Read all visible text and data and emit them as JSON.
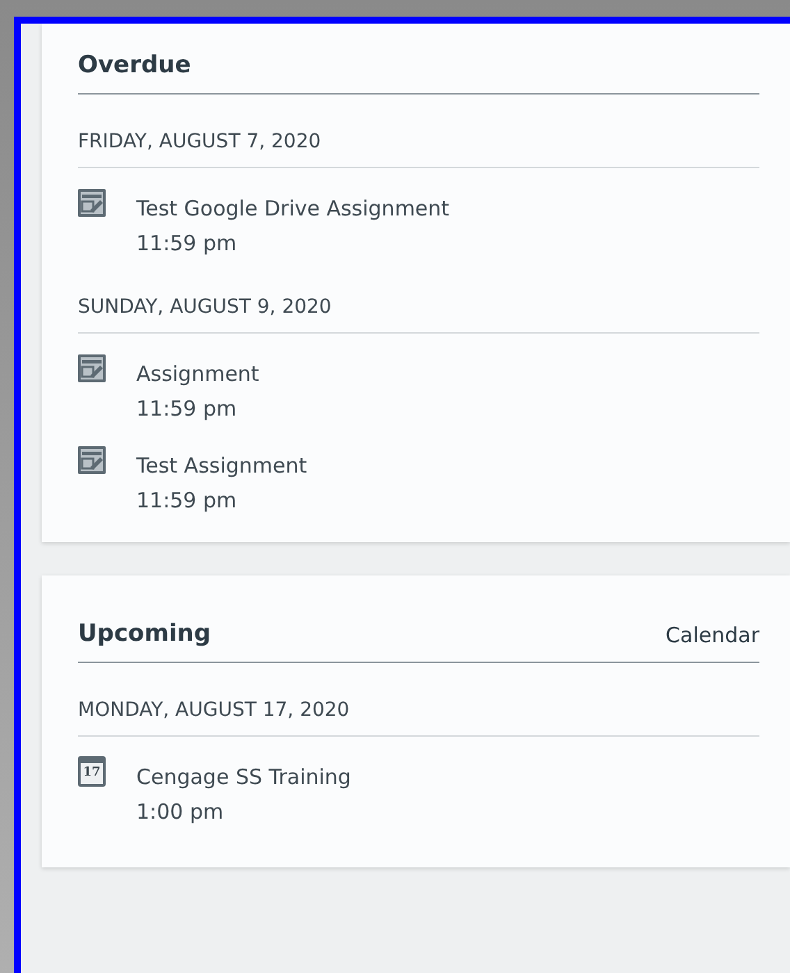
{
  "sections": [
    {
      "title": "Overdue",
      "groups": [
        {
          "date": "FRIDAY, AUGUST 7, 2020",
          "items": [
            {
              "kind": "assignment",
              "title": "Test Google Drive Assignment",
              "time": "11:59 pm"
            }
          ]
        },
        {
          "date": "SUNDAY, AUGUST 9, 2020",
          "items": [
            {
              "kind": "assignment",
              "title": "Assignment",
              "time": "11:59 pm"
            },
            {
              "kind": "assignment",
              "title": "Test Assignment",
              "time": "11:59 pm"
            }
          ]
        }
      ]
    },
    {
      "title": "Upcoming",
      "link": "Calendar",
      "groups": [
        {
          "date": "MONDAY, AUGUST 17, 2020",
          "items": [
            {
              "kind": "event",
              "day": "17",
              "title": "Cengage SS Training",
              "time": "1:00 pm"
            }
          ]
        }
      ]
    }
  ]
}
